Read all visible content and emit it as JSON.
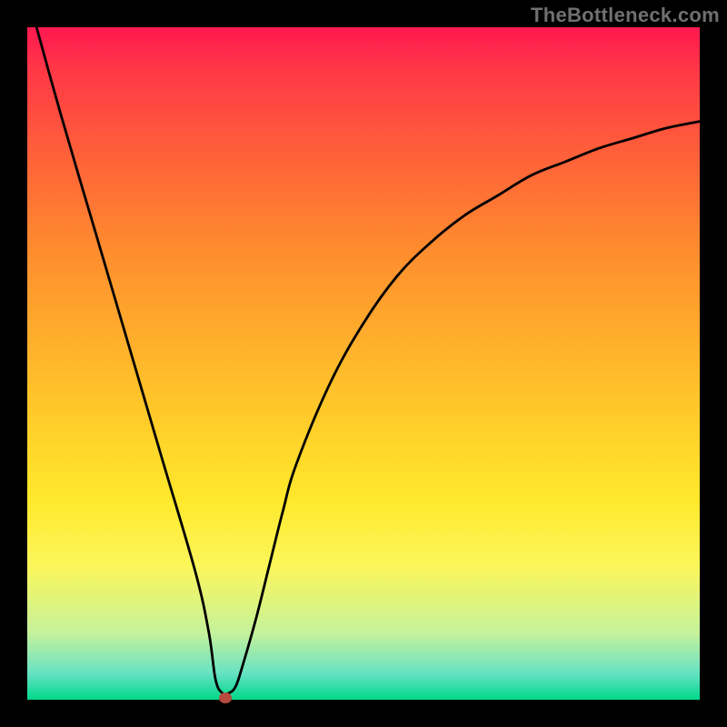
{
  "watermark": "TheBottleneck.com",
  "chart_data": {
    "type": "line",
    "title": "",
    "xlabel": "",
    "ylabel": "",
    "xlim": [
      0,
      100
    ],
    "ylim": [
      0,
      100
    ],
    "series": [
      {
        "name": "curve",
        "x": [
          0,
          5,
          10,
          15,
          20,
          25,
          27,
          28,
          29,
          30,
          31,
          32,
          34,
          36,
          38,
          40,
          45,
          50,
          55,
          60,
          65,
          70,
          75,
          80,
          85,
          90,
          95,
          100
        ],
        "values": [
          105,
          87,
          70,
          53,
          36,
          19,
          10,
          3,
          1,
          1,
          2,
          5,
          12,
          20,
          28,
          35,
          47,
          56,
          63,
          68,
          72,
          75,
          78,
          80,
          82,
          83.5,
          85,
          86
        ]
      }
    ],
    "marker": {
      "x": 29.5,
      "y": 0.3
    },
    "background_gradient": {
      "top": "#ff1850",
      "bottom": "#00d889"
    }
  }
}
